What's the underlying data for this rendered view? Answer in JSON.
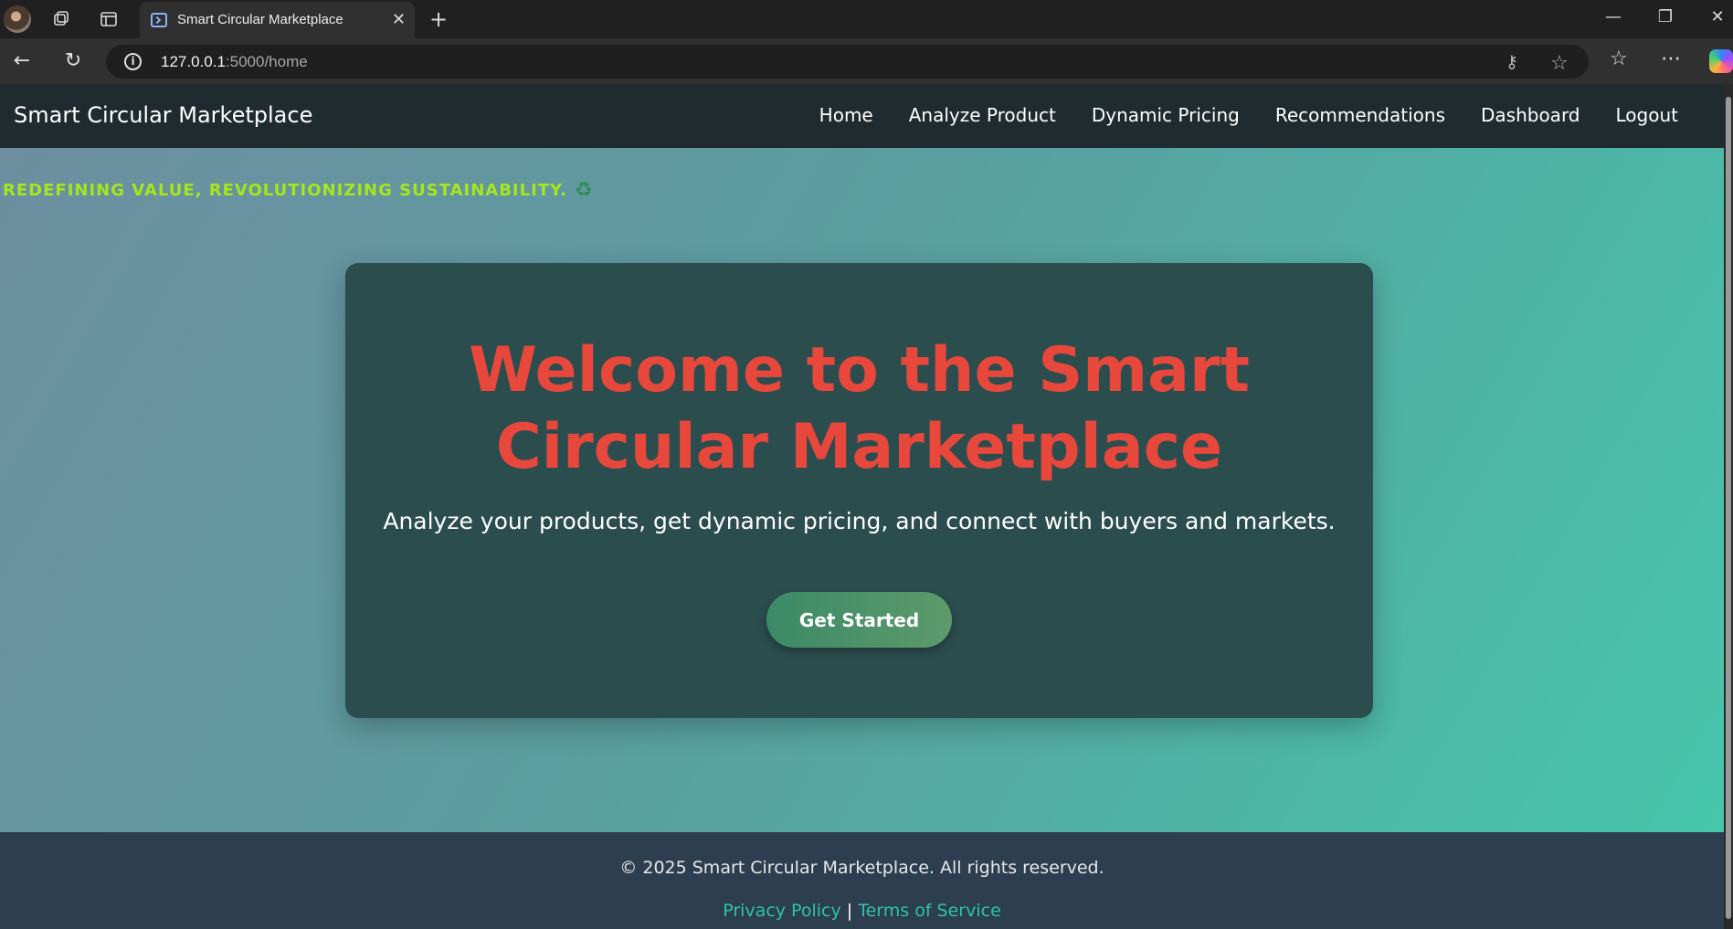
{
  "browser": {
    "tab_title": "Smart Circular Marketplace",
    "url_host": "127.0.0.1",
    "url_path": ":5000/home"
  },
  "site": {
    "brand": "Smart Circular Marketplace",
    "nav": [
      "Home",
      "Analyze Product",
      "Dynamic Pricing",
      "Recommendations",
      "Dashboard",
      "Logout"
    ],
    "tagline": "REDEFINING VALUE, REVOLUTIONIZING SUSTAINABILITY.",
    "hero": {
      "title": "Welcome to the Smart Circular Marketplace",
      "subtitle": "Analyze your products, get dynamic pricing, and connect with buyers and markets.",
      "cta": "Get Started"
    },
    "footer": {
      "copyright": "© 2025 Smart Circular Marketplace. All rights reserved.",
      "privacy": "Privacy Policy",
      "separator": "|",
      "terms": "Terms of Service"
    }
  },
  "colors": {
    "accent_red": "#e8483c",
    "tagline_green": "#a6e61c",
    "link_teal": "#2ec4a6",
    "footer_bg": "#2c3e50"
  }
}
